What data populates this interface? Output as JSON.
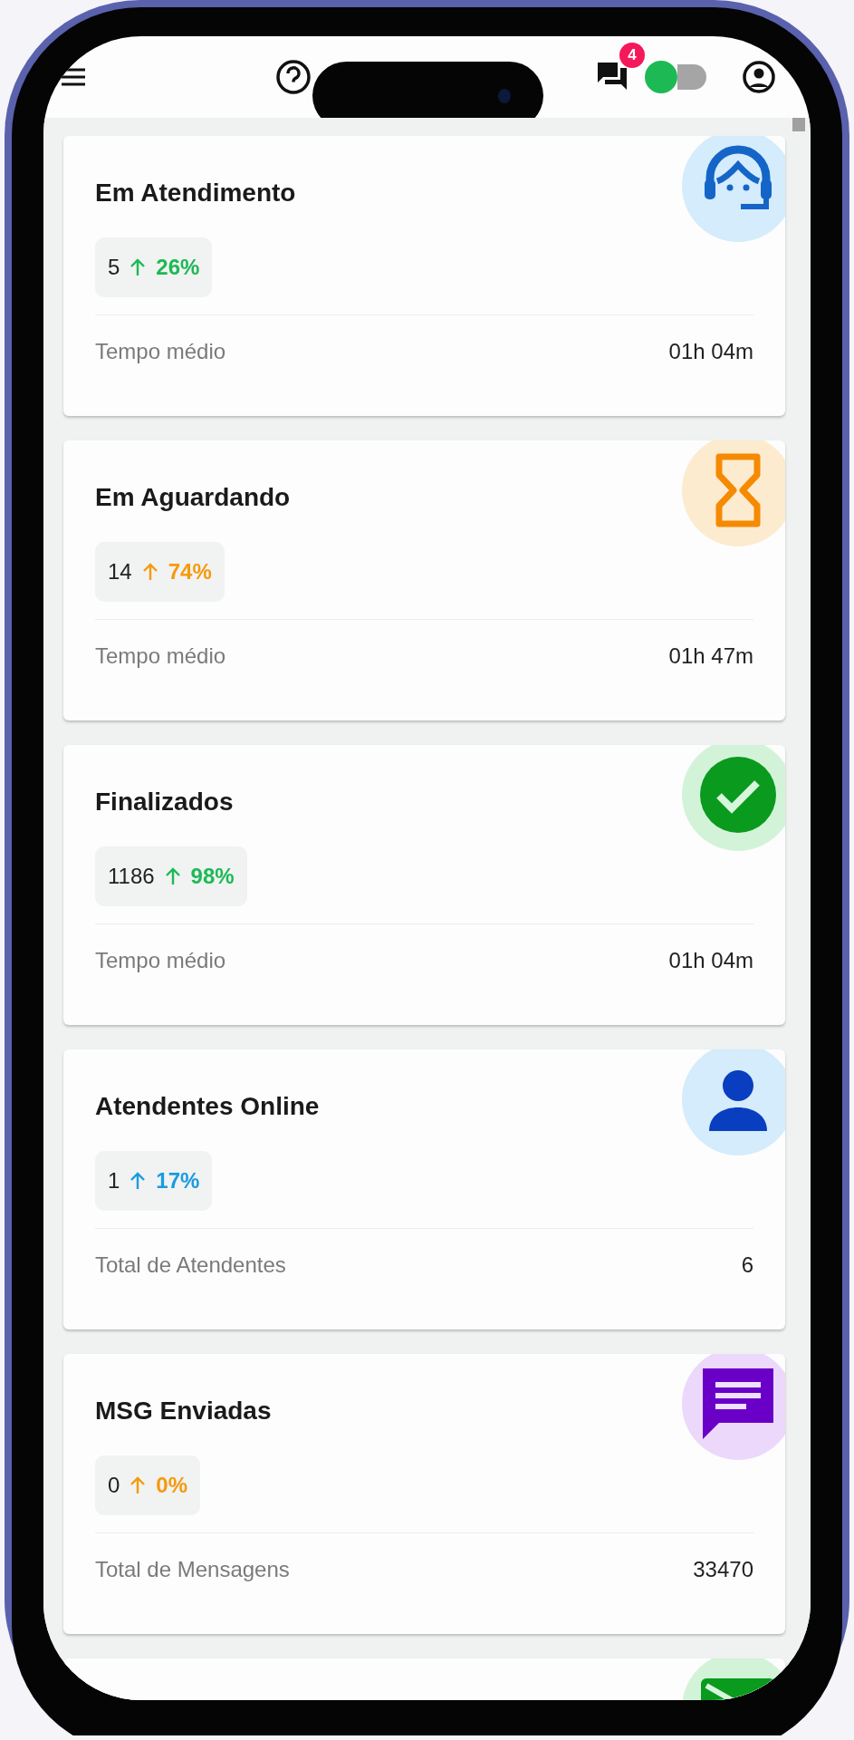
{
  "top_bar": {
    "notification_count": "4",
    "status_indicator": {
      "online": true
    }
  },
  "cards": [
    {
      "kind": "agent",
      "title": "Em Atendimento",
      "count": "5",
      "trend": "26%",
      "color": "#1db954",
      "footer_label": "Tempo médio",
      "footer_value": "01h 04m"
    },
    {
      "kind": "hourglass",
      "title": "Em Aguardando",
      "count": "14",
      "trend": "74%",
      "color": "#f59a0c",
      "footer_label": "Tempo médio",
      "footer_value": "01h 47m"
    },
    {
      "kind": "check",
      "title": "Finalizados",
      "count": "1186",
      "trend": "98%",
      "color": "#1db954",
      "footer_label": "Tempo médio",
      "footer_value": "01h 04m"
    },
    {
      "kind": "person",
      "title": "Atendentes Online",
      "count": "1",
      "trend": "17%",
      "color": "#1a9be0",
      "footer_label": "Total de Atendentes",
      "footer_value": "6"
    },
    {
      "kind": "message",
      "title": "MSG Enviadas",
      "count": "0",
      "trend": "0%",
      "color": "#f59a0c",
      "footer_label": "Total de Mensagens",
      "footer_value": "33470"
    },
    {
      "kind": "send"
    }
  ]
}
